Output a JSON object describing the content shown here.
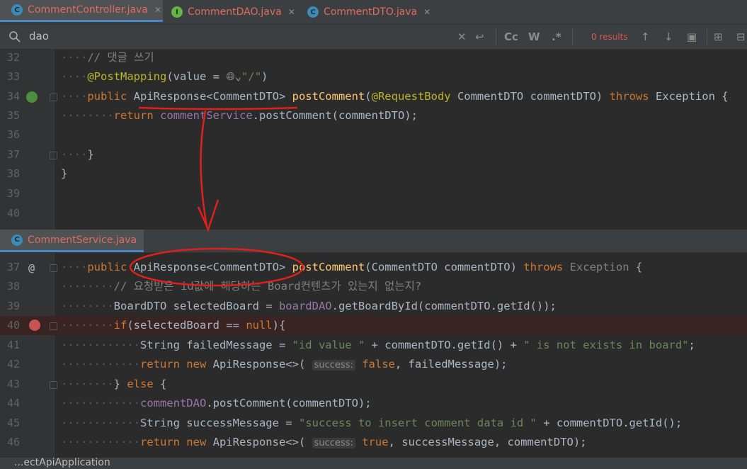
{
  "tabs": [
    {
      "label": "CommentController.java",
      "icon": "C",
      "active": true
    },
    {
      "label": "CommentDAO.java",
      "icon": "I",
      "active": false
    },
    {
      "label": "CommentDTO.java",
      "icon": "C",
      "active": false
    }
  ],
  "search": {
    "query": "dao",
    "results": "0 results",
    "match_case": "Cc",
    "words": "W",
    "regex": ".*"
  },
  "top_editor": {
    "line_numbers": [
      "32",
      "33",
      "34",
      "35",
      "36",
      "37",
      "38",
      "39",
      "40"
    ]
  },
  "bottom_editor": {
    "tab_label": "CommentService.java",
    "line_numbers": [
      "37",
      "38",
      "39",
      "40",
      "41",
      "42",
      "43",
      "44",
      "45",
      "46"
    ],
    "hint_success": "success:"
  },
  "status_partial": "...ectApiApplication"
}
